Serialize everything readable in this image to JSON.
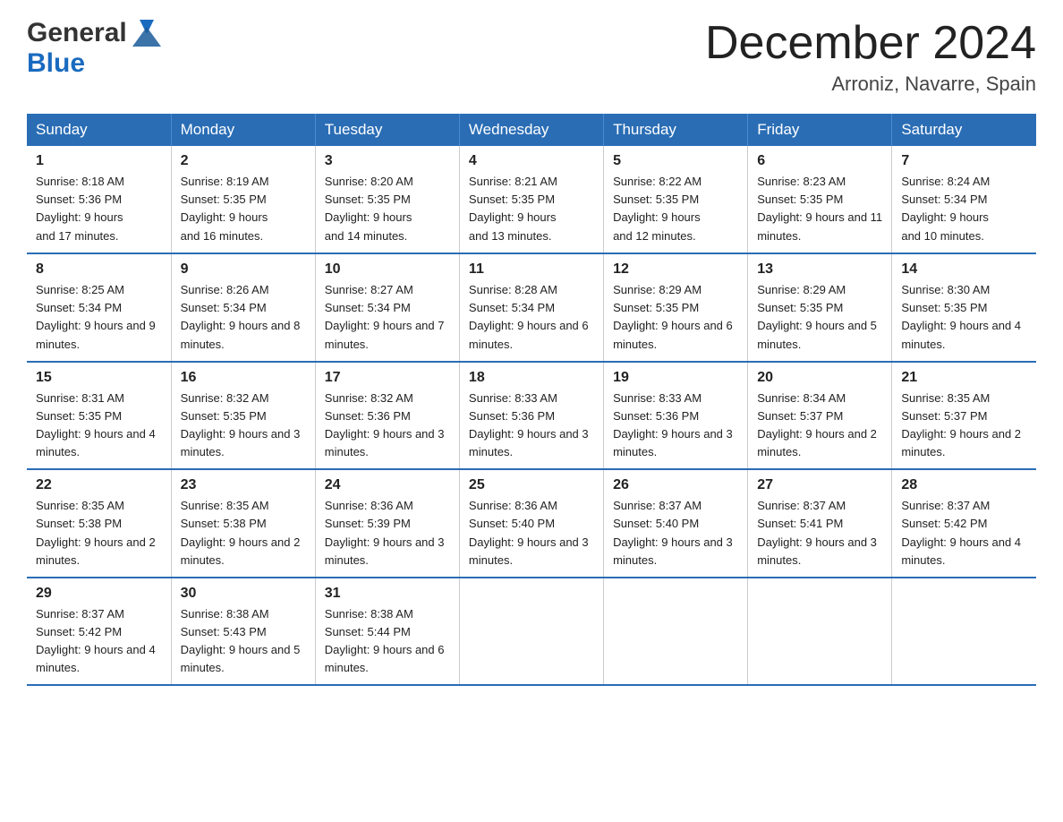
{
  "header": {
    "logo_general": "General",
    "logo_blue": "Blue",
    "month_title": "December 2024",
    "location": "Arroniz, Navarre, Spain"
  },
  "days_of_week": [
    "Sunday",
    "Monday",
    "Tuesday",
    "Wednesday",
    "Thursday",
    "Friday",
    "Saturday"
  ],
  "weeks": [
    [
      {
        "date": "1",
        "sunrise": "8:18 AM",
        "sunset": "5:36 PM",
        "daylight": "9 hours and 17 minutes."
      },
      {
        "date": "2",
        "sunrise": "8:19 AM",
        "sunset": "5:35 PM",
        "daylight": "9 hours and 16 minutes."
      },
      {
        "date": "3",
        "sunrise": "8:20 AM",
        "sunset": "5:35 PM",
        "daylight": "9 hours and 14 minutes."
      },
      {
        "date": "4",
        "sunrise": "8:21 AM",
        "sunset": "5:35 PM",
        "daylight": "9 hours and 13 minutes."
      },
      {
        "date": "5",
        "sunrise": "8:22 AM",
        "sunset": "5:35 PM",
        "daylight": "9 hours and 12 minutes."
      },
      {
        "date": "6",
        "sunrise": "8:23 AM",
        "sunset": "5:35 PM",
        "daylight": "9 hours and 11 minutes."
      },
      {
        "date": "7",
        "sunrise": "8:24 AM",
        "sunset": "5:34 PM",
        "daylight": "9 hours and 10 minutes."
      }
    ],
    [
      {
        "date": "8",
        "sunrise": "8:25 AM",
        "sunset": "5:34 PM",
        "daylight": "9 hours and 9 minutes."
      },
      {
        "date": "9",
        "sunrise": "8:26 AM",
        "sunset": "5:34 PM",
        "daylight": "9 hours and 8 minutes."
      },
      {
        "date": "10",
        "sunrise": "8:27 AM",
        "sunset": "5:34 PM",
        "daylight": "9 hours and 7 minutes."
      },
      {
        "date": "11",
        "sunrise": "8:28 AM",
        "sunset": "5:34 PM",
        "daylight": "9 hours and 6 minutes."
      },
      {
        "date": "12",
        "sunrise": "8:29 AM",
        "sunset": "5:35 PM",
        "daylight": "9 hours and 6 minutes."
      },
      {
        "date": "13",
        "sunrise": "8:29 AM",
        "sunset": "5:35 PM",
        "daylight": "9 hours and 5 minutes."
      },
      {
        "date": "14",
        "sunrise": "8:30 AM",
        "sunset": "5:35 PM",
        "daylight": "9 hours and 4 minutes."
      }
    ],
    [
      {
        "date": "15",
        "sunrise": "8:31 AM",
        "sunset": "5:35 PM",
        "daylight": "9 hours and 4 minutes."
      },
      {
        "date": "16",
        "sunrise": "8:32 AM",
        "sunset": "5:35 PM",
        "daylight": "9 hours and 3 minutes."
      },
      {
        "date": "17",
        "sunrise": "8:32 AM",
        "sunset": "5:36 PM",
        "daylight": "9 hours and 3 minutes."
      },
      {
        "date": "18",
        "sunrise": "8:33 AM",
        "sunset": "5:36 PM",
        "daylight": "9 hours and 3 minutes."
      },
      {
        "date": "19",
        "sunrise": "8:33 AM",
        "sunset": "5:36 PM",
        "daylight": "9 hours and 3 minutes."
      },
      {
        "date": "20",
        "sunrise": "8:34 AM",
        "sunset": "5:37 PM",
        "daylight": "9 hours and 2 minutes."
      },
      {
        "date": "21",
        "sunrise": "8:35 AM",
        "sunset": "5:37 PM",
        "daylight": "9 hours and 2 minutes."
      }
    ],
    [
      {
        "date": "22",
        "sunrise": "8:35 AM",
        "sunset": "5:38 PM",
        "daylight": "9 hours and 2 minutes."
      },
      {
        "date": "23",
        "sunrise": "8:35 AM",
        "sunset": "5:38 PM",
        "daylight": "9 hours and 2 minutes."
      },
      {
        "date": "24",
        "sunrise": "8:36 AM",
        "sunset": "5:39 PM",
        "daylight": "9 hours and 3 minutes."
      },
      {
        "date": "25",
        "sunrise": "8:36 AM",
        "sunset": "5:40 PM",
        "daylight": "9 hours and 3 minutes."
      },
      {
        "date": "26",
        "sunrise": "8:37 AM",
        "sunset": "5:40 PM",
        "daylight": "9 hours and 3 minutes."
      },
      {
        "date": "27",
        "sunrise": "8:37 AM",
        "sunset": "5:41 PM",
        "daylight": "9 hours and 3 minutes."
      },
      {
        "date": "28",
        "sunrise": "8:37 AM",
        "sunset": "5:42 PM",
        "daylight": "9 hours and 4 minutes."
      }
    ],
    [
      {
        "date": "29",
        "sunrise": "8:37 AM",
        "sunset": "5:42 PM",
        "daylight": "9 hours and 4 minutes."
      },
      {
        "date": "30",
        "sunrise": "8:38 AM",
        "sunset": "5:43 PM",
        "daylight": "9 hours and 5 minutes."
      },
      {
        "date": "31",
        "sunrise": "8:38 AM",
        "sunset": "5:44 PM",
        "daylight": "9 hours and 6 minutes."
      },
      {
        "date": "",
        "sunrise": "",
        "sunset": "",
        "daylight": ""
      },
      {
        "date": "",
        "sunrise": "",
        "sunset": "",
        "daylight": ""
      },
      {
        "date": "",
        "sunrise": "",
        "sunset": "",
        "daylight": ""
      },
      {
        "date": "",
        "sunrise": "",
        "sunset": "",
        "daylight": ""
      }
    ]
  ],
  "labels": {
    "sunrise": "Sunrise:",
    "sunset": "Sunset:",
    "daylight": "Daylight:"
  }
}
